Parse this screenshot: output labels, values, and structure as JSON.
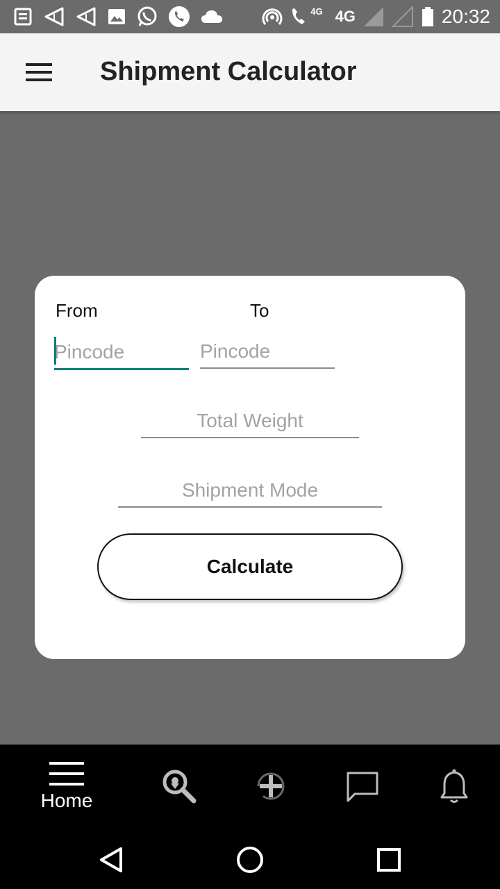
{
  "status_bar": {
    "time": "20:32",
    "network": "4G",
    "network_small": "4G",
    "icons": [
      "news-icon",
      "send-icon",
      "send-icon",
      "image-icon",
      "whatsapp-icon",
      "phone-icon",
      "cloud-icon",
      "hotspot-icon",
      "wifi-calling-icon",
      "signal-icon",
      "signal-icon",
      "battery-icon"
    ]
  },
  "app_bar": {
    "title": "Shipment Calculator",
    "menu_icon": "menu-icon"
  },
  "form": {
    "from_label": "From",
    "to_label": "To",
    "from_placeholder": "Pincode",
    "to_placeholder": "Pincode",
    "weight_placeholder": "Total Weight",
    "mode_placeholder": "Shipment Mode",
    "calculate_label": "Calculate"
  },
  "bottom_nav": {
    "items": [
      {
        "icon": "menu-icon",
        "label": "Home",
        "active": true
      },
      {
        "icon": "search-location-icon",
        "label": ""
      },
      {
        "icon": "add-circle-icon",
        "label": ""
      },
      {
        "icon": "chat-icon",
        "label": ""
      },
      {
        "icon": "bell-icon",
        "label": ""
      }
    ]
  },
  "system_nav": {
    "icons": [
      "back-icon",
      "home-icon",
      "recent-apps-icon"
    ]
  },
  "colors": {
    "overlay": "#6b6b6b",
    "app_bar": "#f4f4f4",
    "accent": "#0e7c72",
    "nav_background": "#000000"
  }
}
